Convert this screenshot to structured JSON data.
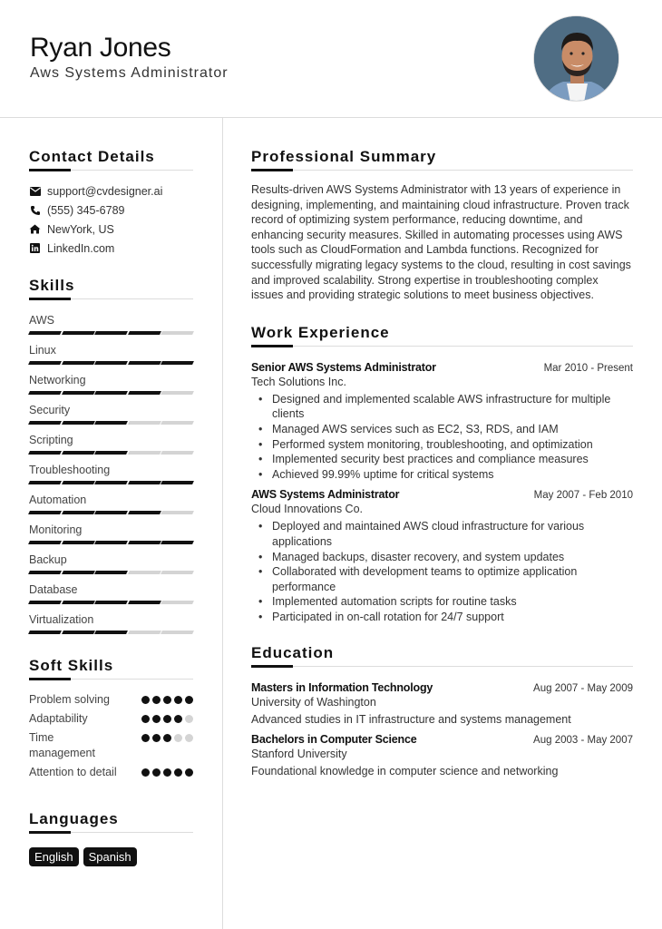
{
  "header": {
    "name": "Ryan Jones",
    "role": "Aws Systems Administrator",
    "avatar_alt": "profile-photo"
  },
  "sidebar": {
    "contact": {
      "title": "Contact Details",
      "items": [
        {
          "icon": "envelope-icon",
          "text": "support@cvdesigner.ai"
        },
        {
          "icon": "phone-icon",
          "text": "(555) 345-6789"
        },
        {
          "icon": "home-icon",
          "text": "NewYork, US"
        },
        {
          "icon": "linkedin-icon",
          "text": "LinkedIn.com"
        }
      ]
    },
    "skills": {
      "title": "Skills",
      "max": 5,
      "items": [
        {
          "name": "AWS",
          "level": 4
        },
        {
          "name": "Linux",
          "level": 5
        },
        {
          "name": "Networking",
          "level": 4
        },
        {
          "name": "Security",
          "level": 3
        },
        {
          "name": "Scripting",
          "level": 3
        },
        {
          "name": "Troubleshooting",
          "level": 5
        },
        {
          "name": "Automation",
          "level": 4
        },
        {
          "name": "Monitoring",
          "level": 5
        },
        {
          "name": "Backup",
          "level": 3
        },
        {
          "name": "Database",
          "level": 4
        },
        {
          "name": "Virtualization",
          "level": 3
        }
      ]
    },
    "soft_skills": {
      "title": "Soft Skills",
      "max": 5,
      "items": [
        {
          "name": "Problem solving",
          "level": 5
        },
        {
          "name": "Adaptability",
          "level": 4
        },
        {
          "name": "Time management",
          "level": 3
        },
        {
          "name": "Attention to detail",
          "level": 5
        }
      ]
    },
    "languages": {
      "title": "Languages",
      "items": [
        "English",
        "Spanish"
      ]
    }
  },
  "main": {
    "summary": {
      "title": "Professional Summary",
      "text": "Results-driven AWS Systems Administrator with 13 years of experience in designing, implementing, and maintaining cloud infrastructure. Proven track record of optimizing system performance, reducing downtime, and enhancing security measures. Skilled in automating processes using AWS tools such as CloudFormation and Lambda functions. Recognized for successfully migrating legacy systems to the cloud, resulting in cost savings and improved scalability. Strong expertise in troubleshooting complex issues and providing strategic solutions to meet business objectives."
    },
    "experience": {
      "title": "Work Experience",
      "jobs": [
        {
          "title": "Senior AWS Systems Administrator",
          "date": "Mar 2010 - Present",
          "org": "Tech Solutions Inc.",
          "bullets": [
            "Designed and implemented scalable AWS infrastructure for multiple clients",
            "Managed AWS services such as EC2, S3, RDS, and IAM",
            "Performed system monitoring, troubleshooting, and optimization",
            "Implemented security best practices and compliance measures",
            "Achieved 99.99% uptime for critical systems"
          ]
        },
        {
          "title": "AWS Systems Administrator",
          "date": "May 2007 - Feb 2010",
          "org": "Cloud Innovations Co.",
          "bullets": [
            "Deployed and maintained AWS cloud infrastructure for various applications",
            "Managed backups, disaster recovery, and system updates",
            "Collaborated with development teams to optimize application performance",
            "Implemented automation scripts for routine tasks",
            "Participated in on-call rotation for 24/7 support"
          ]
        }
      ]
    },
    "education": {
      "title": "Education",
      "items": [
        {
          "degree": "Masters in Information Technology",
          "date": "Aug 2007 - May 2009",
          "school": "University of Washington",
          "desc": "Advanced studies in IT infrastructure and systems management"
        },
        {
          "degree": "Bachelors in Computer Science",
          "date": "Aug 2003 - May 2007",
          "school": "Stanford University",
          "desc": "Foundational knowledge in computer science and networking"
        }
      ]
    }
  }
}
